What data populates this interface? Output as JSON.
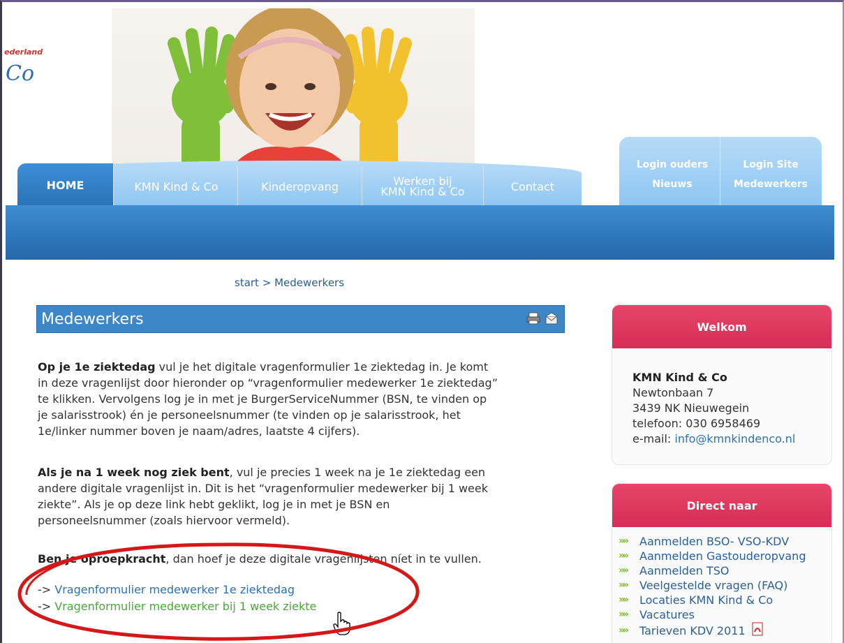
{
  "header": {
    "logo_small": "ederland",
    "logo_large": "Co"
  },
  "nav": {
    "items": [
      {
        "label": "HOME"
      },
      {
        "label": "KMN Kind & Co"
      },
      {
        "label": "Kinderopvang"
      },
      {
        "label_line1": "Werken bij",
        "label_line2": "KMN Kind & Co"
      },
      {
        "label": "Contact"
      }
    ],
    "right": [
      {
        "line1": "Login ouders",
        "line2": "Nieuws"
      },
      {
        "line1": "Login Site",
        "line2": "Medewerkers"
      }
    ]
  },
  "breadcrumb": {
    "start": "start",
    "separator": ">",
    "current": "Medewerkers"
  },
  "content": {
    "title": "Medewerkers",
    "p1_bold": "Op je 1e ziektedag",
    "p1_l1": " vul je het digitale vragenformulier 1e ziektedag in. Je komt",
    "p1_l2": "in deze vragenlijst door hieronder op “vragenformulier medewerker 1e ziektedag”",
    "p1_l3": "te klikken. Vervolgens log je in met je BurgerServiceNummer (BSN, te vinden op",
    "p1_l4": "je salarisstrook) én je personeelsnummer (te vinden op je salarisstrook, het",
    "p1_l5": "1e/linker nummer boven je naam/adres, laatste 4 cijfers).",
    "p2_bold": "Als je na 1 week nog ziek bent",
    "p2_l1": ", vul je precies 1 week na je 1e ziektedag een",
    "p2_l2": "andere digitale vragenlijst in. Dit is het “vragenformulier medewerker bij 1 week",
    "p2_l3": "ziekte”. Als je op deze link hebt geklikt, log je in met je BSN en",
    "p2_l4": "personeelsnummer (zoals hiervoor vermeld).",
    "p3_bold": "Ben je oproepkracht",
    "p3_rest": ", dan hoef je deze digitale vragenlijsten níet in te vullen.",
    "link_prefix": "->",
    "link1": "Vragenformulier medewerker 1e ziektedag",
    "link2": "Vragenformulier medewerker bij 1 week ziekte",
    "link1_color": "#2a72b5",
    "link2_color": "#4aa83a"
  },
  "sidebar": {
    "welkom_title": "Welkom",
    "org_name": "KMN Kind & Co",
    "street": "Newtonbaan 7",
    "city": "3439 NK  Nieuwegein",
    "phone": "telefoon: 030 6958469",
    "email_label": "e-mail: ",
    "email": "info@kmnkindenco.nl",
    "direct_title": "Direct naar",
    "direct_items": [
      "Aanmelden BSO- VSO-KDV",
      "Aanmelden Gastouderopvang",
      "Aanmelden TSO",
      "Veelgestelde vragen (FAQ)",
      "Locaties KMN Kind & Co",
      "Vacatures",
      "Tarieven KDV 2011"
    ]
  },
  "colors": {
    "nav_blue": "#3d87c9",
    "sidebar_pink": "#d62d56",
    "annotation_red": "#d41818"
  }
}
